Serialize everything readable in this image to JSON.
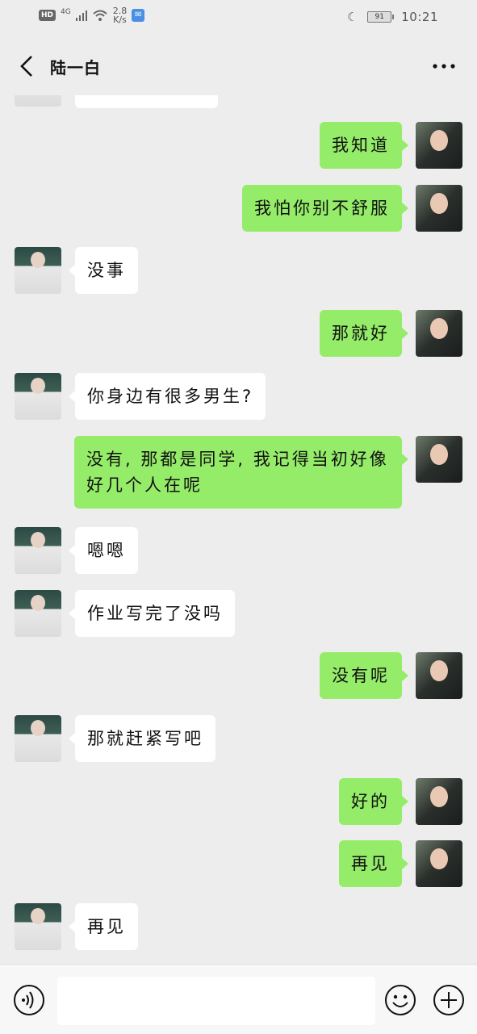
{
  "status_bar": {
    "hd": "HD",
    "network": "4G",
    "speed_value": "2.8",
    "speed_unit": "K/s",
    "battery": "91",
    "time": "10:21"
  },
  "header": {
    "title": "陆一白"
  },
  "messages": [
    {
      "from": "them",
      "text": ""
    },
    {
      "from": "me",
      "text": "我知道"
    },
    {
      "from": "me",
      "text": "我怕你别不舒服"
    },
    {
      "from": "them",
      "text": "没事"
    },
    {
      "from": "me",
      "text": "那就好"
    },
    {
      "from": "them",
      "text": "你身边有很多男生?"
    },
    {
      "from": "me",
      "text": "没有, 那都是同学, 我记得当初好像好几个人在呢"
    },
    {
      "from": "them",
      "text": "嗯嗯"
    },
    {
      "from": "them",
      "text": "作业写完了没吗"
    },
    {
      "from": "me",
      "text": "没有呢"
    },
    {
      "from": "them",
      "text": "那就赶紧写吧"
    },
    {
      "from": "me",
      "text": "好的"
    },
    {
      "from": "me",
      "text": "再见"
    },
    {
      "from": "them",
      "text": "再见"
    }
  ],
  "input": {
    "value": ""
  },
  "colors": {
    "outgoing_bubble": "#95ec69",
    "incoming_bubble": "#ffffff",
    "background": "#ededed"
  }
}
